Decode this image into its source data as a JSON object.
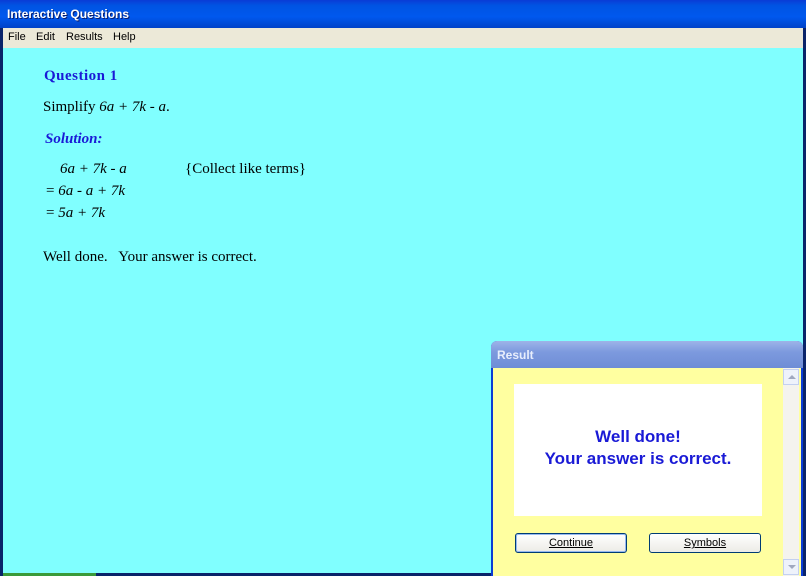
{
  "window": {
    "title": "Interactive Questions"
  },
  "menu": {
    "items": [
      "File",
      "Edit",
      "Results",
      "Help"
    ]
  },
  "question": {
    "heading": "Question 1",
    "prompt_prefix": "Simplify ",
    "prompt_expr": "6a + 7k - a",
    "prompt_suffix": "."
  },
  "solution": {
    "heading": "Solution:",
    "lines": [
      {
        "prefix": "",
        "expr": "6a + 7k - a",
        "note": "{Collect like terms}"
      },
      {
        "prefix": "= ",
        "expr": "6a - a + 7k",
        "note": ""
      },
      {
        "prefix": "= ",
        "expr": "5a + 7k",
        "note": ""
      }
    ],
    "feedback": "Well done.   Your answer is correct."
  },
  "dialog": {
    "title": "Result",
    "message_line1": "Well done!",
    "message_line2": "Your answer is correct.",
    "continue_label": "Continue",
    "symbols_label": "Symbols"
  }
}
